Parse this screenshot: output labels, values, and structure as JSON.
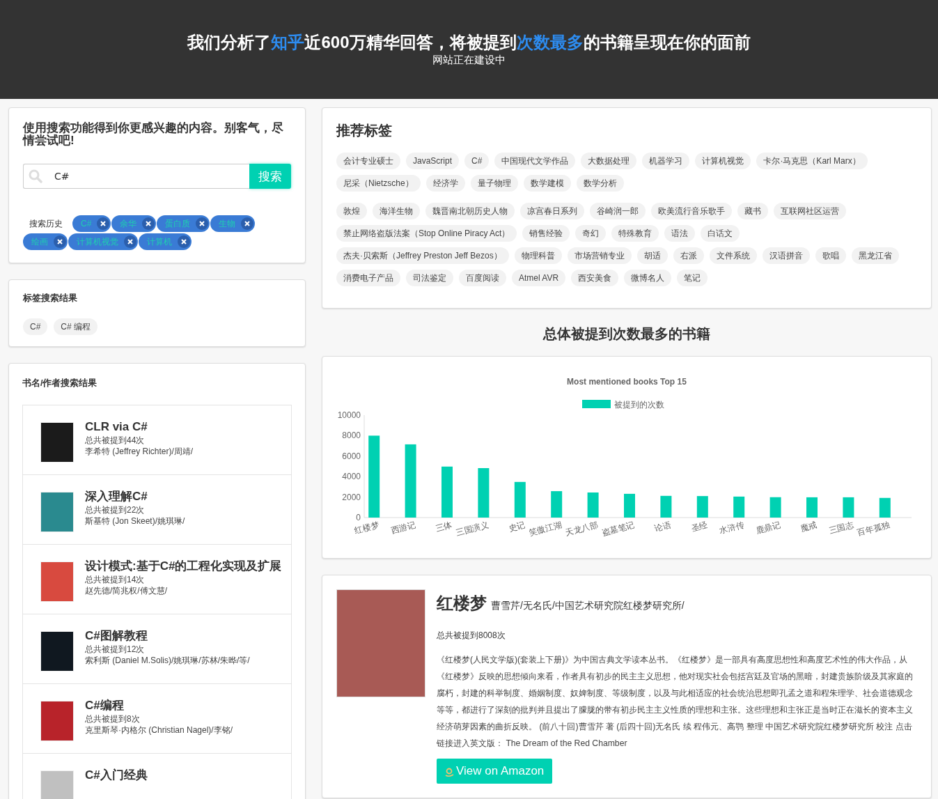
{
  "header": {
    "title": [
      {
        "text": "我们分析了",
        "highlight": false
      },
      {
        "text": "知乎",
        "highlight": true
      },
      {
        "text": "近600万精华回答，将被提到",
        "highlight": false
      },
      {
        "text": "次数最多",
        "highlight": true
      },
      {
        "text": "的书籍呈现在你的面前",
        "highlight": false
      }
    ],
    "subtitle": "网站正在建设中"
  },
  "search_panel": {
    "title": "使用搜索功能得到你更感兴趣的内容。别客气，尽情尝试吧!",
    "search": {
      "value": "C#",
      "button": "搜索"
    },
    "history_label": "搜索历史",
    "history": [
      "C#",
      "余华",
      "蛋白质",
      "生物",
      "绘画",
      "计算机视觉",
      "计算机"
    ]
  },
  "tag_results": {
    "title": "标签搜索结果",
    "tags": [
      "C#",
      "C# 编程"
    ]
  },
  "book_results": {
    "title": "书名/作者搜索结果",
    "books": [
      {
        "title": "CLR via C#",
        "count": "总共被提到44次",
        "authors": "李希特 (Jeffrey Richter)/周靖/"
      },
      {
        "title": "深入理解C#",
        "count": "总共被提到22次",
        "authors": "斯基特 (Jon Skeet)/姚琪琳/"
      },
      {
        "title": "设计模式:基于C#的工程化实现及扩展",
        "count": "总共被提到14次",
        "authors": "赵先德/简兆权/傅文慧/"
      },
      {
        "title": "C#图解教程",
        "count": "总共被提到12次",
        "authors": "索利斯 (Daniel M.Solis)/姚琪琳/苏林/朱晔/等/"
      },
      {
        "title": "C#编程",
        "count": "总共被提到8次",
        "authors": "克里斯琴·内格尔 (Christian Nagel)/李铭/"
      },
      {
        "title": "C#入门经典"
      }
    ]
  },
  "recommended_tags": {
    "title": "推荐标签",
    "groups": [
      [
        "会计专业硕士",
        "JavaScript",
        "C#",
        "中国现代文学作品",
        "大数据处理",
        "机器学习",
        "计算机视觉",
        "卡尔·马克思（Karl Marx）",
        "尼采（Nietzsche）",
        "经济学",
        "量子物理",
        "数学建模",
        "数学分析"
      ],
      [
        "敦煌",
        "海洋生物",
        "魏晋南北朝历史人物",
        "凉宫春日系列",
        "谷崎润一郎",
        "欧美流行音乐歌手",
        "藏书",
        "互联网社区运营",
        "禁止网络盗版法案（Stop Online Piracy Act）",
        "销售经验",
        "奇幻",
        "特殊教育",
        "语法",
        "白话文",
        "杰夫·贝索斯（Jeffrey Preston Jeff Bezos）",
        "物理科普",
        "市场营销专业",
        "胡适",
        "右派",
        "文件系统",
        "汉语拼音",
        "歌唱",
        "黑龙江省",
        "消费电子产品",
        "司法鉴定",
        "百度阅读",
        "Atmel AVR",
        "西安美食",
        "微博名人",
        "笔记"
      ]
    ]
  },
  "chart_section": {
    "heading": "总体被提到次数最多的书籍",
    "chart_data": {
      "type": "bar",
      "title": "Most mentioned books Top 15",
      "categories": [
        "红楼梦",
        "西游记",
        "三体",
        "三国演义",
        "史记",
        "笑傲江湖",
        "天龙八部",
        "盗墓笔记",
        "论语",
        "圣经",
        "水浒传",
        "鹿鼎记",
        "魔戒",
        "三国志",
        "百年孤独"
      ],
      "series": [
        {
          "name": "被提到的次数",
          "color": "#00d1b2",
          "values": [
            8000,
            7150,
            4980,
            4830,
            3480,
            2580,
            2450,
            2320,
            2120,
            2100,
            2050,
            1990,
            1980,
            1980,
            1920
          ]
        }
      ],
      "ylim": [
        0,
        10000
      ],
      "yticks": [
        0,
        2000,
        4000,
        6000,
        8000,
        10000
      ]
    }
  },
  "detail": {
    "title": "红楼梦",
    "authors": "曹雪芹/无名氏/中国艺术研究院红楼梦研究所/",
    "count": "总共被提到8008次",
    "description": "《红楼梦(人民文学版)(套装上下册)》为中国古典文学读本丛书。《红楼梦》是一部具有高度思想性和高度艺术性的伟大作品，从《红楼梦》反映的思想倾向来看，作者具有初步的民主主义思想，他对现实社会包括宫廷及官场的黑暗，封建贵族阶级及其家庭的腐朽，封建的科举制度、婚姻制度、奴婢制度、等级制度，以及与此相适应的社会统治思想即孔孟之道和程朱理学、社会道德观念等等，都进行了深刻的批判并且提出了朦胧的带有初步民主主义性质的理想和主张。这些理想和主张正是当时正在滋长的资本主义经济萌芽因素的曲折反映。 (前八十回)曹雪芹 著 (后四十回)无名氏 续  程伟元、高鹗 整理 中国艺术研究院红楼梦研究所 校注 点击链接进入英文版： The Dream of the Red Chamber",
    "button": "View on Amazon"
  }
}
